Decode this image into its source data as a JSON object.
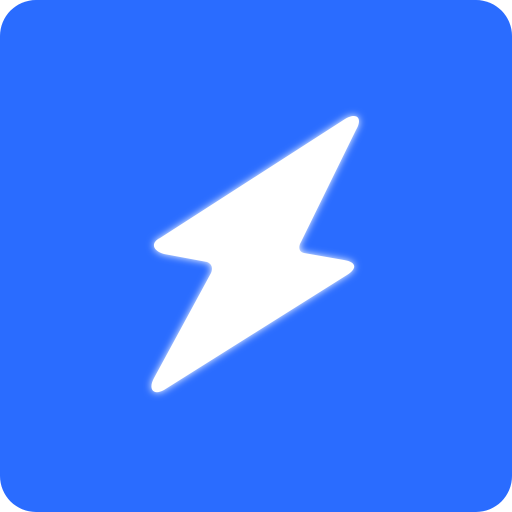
{
  "icon": {
    "name": "lightning-bolt-icon",
    "background_color": "#2A6CFF",
    "glyph_color": "#FFFFFF",
    "glow_color": "#FFFFFF"
  }
}
